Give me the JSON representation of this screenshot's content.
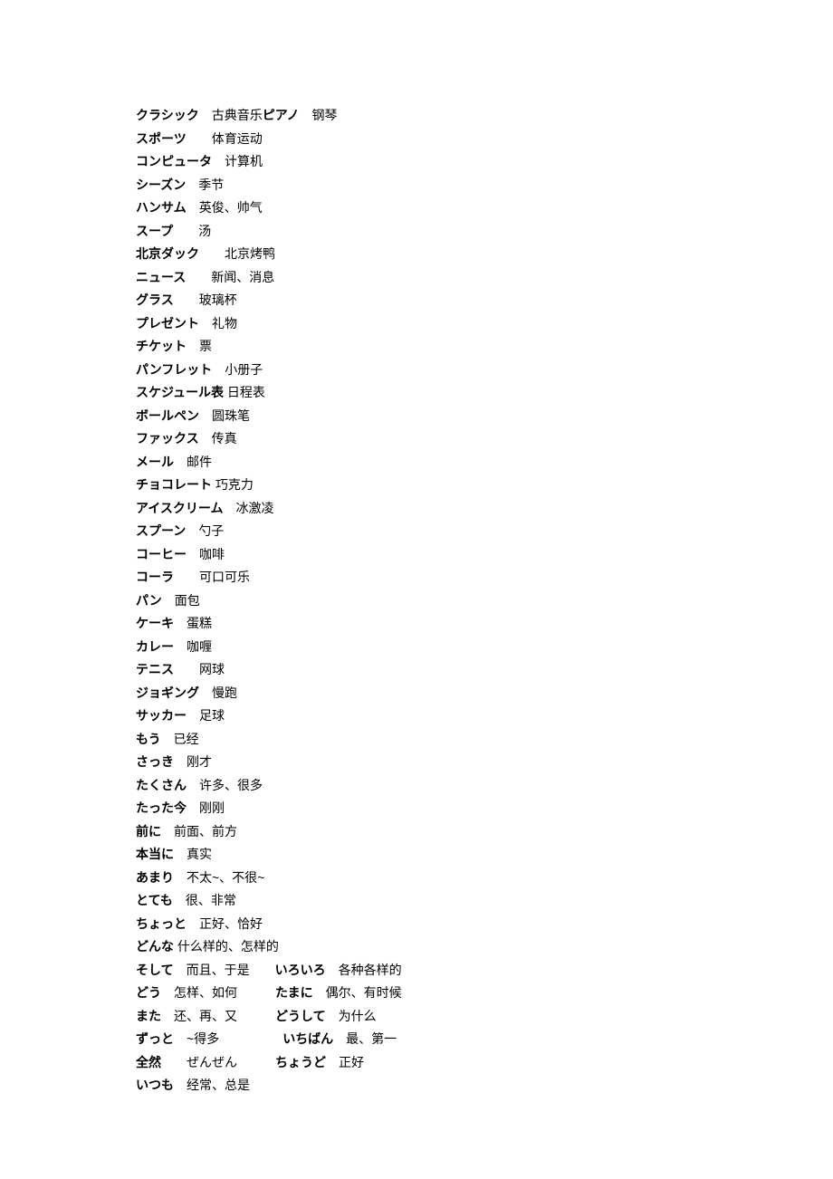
{
  "rows": [
    [
      {
        "t": "クラシック",
        "b": true
      },
      {
        "t": "　古典音乐",
        "b": false
      },
      {
        "t": "ピアノ",
        "b": true
      },
      {
        "t": "　钢琴",
        "b": false
      }
    ],
    [
      {
        "t": "スポーツ",
        "b": true
      },
      {
        "t": "　　体育运动",
        "b": false
      }
    ],
    [
      {
        "t": "コンピュータ",
        "b": true
      },
      {
        "t": "　计算机",
        "b": false
      }
    ],
    [
      {
        "t": "シーズン",
        "b": true
      },
      {
        "t": "　季节",
        "b": false
      }
    ],
    [
      {
        "t": "ハンサム",
        "b": true
      },
      {
        "t": "　英俊、帅气",
        "b": false
      }
    ],
    [
      {
        "t": "スープ",
        "b": true
      },
      {
        "t": "　　汤",
        "b": false
      }
    ],
    [
      {
        "t": "北京ダック",
        "b": true
      },
      {
        "t": "　　北京烤鸭",
        "b": false
      }
    ],
    [
      {
        "t": "ニュース",
        "b": true
      },
      {
        "t": "　　新闻、消息",
        "b": false
      }
    ],
    [
      {
        "t": "グラス",
        "b": true
      },
      {
        "t": "　　玻璃杯",
        "b": false
      }
    ],
    [
      {
        "t": "プレゼント",
        "b": true
      },
      {
        "t": "　礼物",
        "b": false
      }
    ],
    [
      {
        "t": "チケット",
        "b": true
      },
      {
        "t": "　票",
        "b": false
      }
    ],
    [
      {
        "t": "パンフレット",
        "b": true
      },
      {
        "t": "　小册子",
        "b": false
      }
    ],
    [
      {
        "t": "スケジュール表",
        "b": true
      },
      {
        "t": " 日程表",
        "b": false
      }
    ],
    [
      {
        "t": "ボールペン",
        "b": true
      },
      {
        "t": "　圆珠笔",
        "b": false
      }
    ],
    [
      {
        "t": "ファックス",
        "b": true
      },
      {
        "t": "　传真",
        "b": false
      }
    ],
    [
      {
        "t": "メール",
        "b": true
      },
      {
        "t": "　邮件",
        "b": false
      }
    ],
    [
      {
        "t": "チョコレート",
        "b": true
      },
      {
        "t": " 巧克力",
        "b": false
      }
    ],
    [
      {
        "t": "アイスクリーム",
        "b": true
      },
      {
        "t": "　冰激凌",
        "b": false
      }
    ],
    [
      {
        "t": "スプーン",
        "b": true
      },
      {
        "t": "　勺子",
        "b": false
      }
    ],
    [
      {
        "t": "コーヒー",
        "b": true
      },
      {
        "t": "　咖啡",
        "b": false
      }
    ],
    [
      {
        "t": "コーラ",
        "b": true
      },
      {
        "t": "　　可口可乐",
        "b": false
      }
    ],
    [
      {
        "t": "パン",
        "b": true
      },
      {
        "t": "　面包",
        "b": false
      }
    ],
    [
      {
        "t": "ケーキ",
        "b": true
      },
      {
        "t": "　蛋糕",
        "b": false
      }
    ],
    [
      {
        "t": "カレー",
        "b": true
      },
      {
        "t": "　咖喱",
        "b": false
      }
    ],
    [
      {
        "t": "テニス",
        "b": true
      },
      {
        "t": "　　网球",
        "b": false
      }
    ],
    [
      {
        "t": "ジョギング",
        "b": true
      },
      {
        "t": "　慢跑",
        "b": false
      }
    ],
    [
      {
        "t": "サッカー",
        "b": true
      },
      {
        "t": "　足球",
        "b": false
      }
    ],
    [
      {
        "t": "もう",
        "b": true
      },
      {
        "t": "　已经",
        "b": false
      }
    ],
    [
      {
        "t": "さっき",
        "b": true
      },
      {
        "t": "　刚才",
        "b": false
      }
    ],
    [
      {
        "t": "たくさん",
        "b": true
      },
      {
        "t": "　许多、很多",
        "b": false
      }
    ],
    [
      {
        "t": "たった今",
        "b": true
      },
      {
        "t": "　刚刚",
        "b": false
      }
    ],
    [
      {
        "t": "前に",
        "b": true
      },
      {
        "t": "　前面、前方",
        "b": false
      }
    ],
    [
      {
        "t": "本当に",
        "b": true
      },
      {
        "t": "　真实",
        "b": false
      }
    ],
    [
      {
        "t": "あまり",
        "b": true
      },
      {
        "t": "　不太~、不很~",
        "b": false
      }
    ],
    [
      {
        "t": "とても",
        "b": true
      },
      {
        "t": "　很、非常",
        "b": false
      }
    ],
    [
      {
        "t": "ちょっと",
        "b": true
      },
      {
        "t": "　正好、恰好",
        "b": false
      }
    ],
    [
      {
        "t": "どんな",
        "b": true
      },
      {
        "t": " 什么样的、怎样的",
        "b": false
      }
    ],
    [
      {
        "t": "そして",
        "b": true
      },
      {
        "t": "　而且、于是　　",
        "b": false
      },
      {
        "t": "いろいろ",
        "b": true
      },
      {
        "t": "　各种各样的",
        "b": false
      }
    ],
    [
      {
        "t": "どう",
        "b": true
      },
      {
        "t": "　怎样、如何　　　",
        "b": false
      },
      {
        "t": "たまに",
        "b": true
      },
      {
        "t": "　偶尔、有时候",
        "b": false
      }
    ],
    [
      {
        "t": "また",
        "b": true
      },
      {
        "t": "　还、再、又　　　",
        "b": false
      },
      {
        "t": "どうして",
        "b": true
      },
      {
        "t": "　为什么",
        "b": false
      }
    ],
    [
      {
        "t": "ずっと",
        "b": true
      },
      {
        "t": "　~得多　　　　　",
        "b": false
      },
      {
        "t": "いちばん",
        "b": true
      },
      {
        "t": "　最、第一",
        "b": false
      }
    ],
    [
      {
        "t": "全然",
        "b": true
      },
      {
        "t": "　　ぜんぜん　　　",
        "b": false
      },
      {
        "t": "ちょうど",
        "b": true
      },
      {
        "t": "　正好",
        "b": false
      }
    ],
    [
      {
        "t": "いつも",
        "b": true
      },
      {
        "t": "　经常、总是",
        "b": false
      }
    ]
  ]
}
